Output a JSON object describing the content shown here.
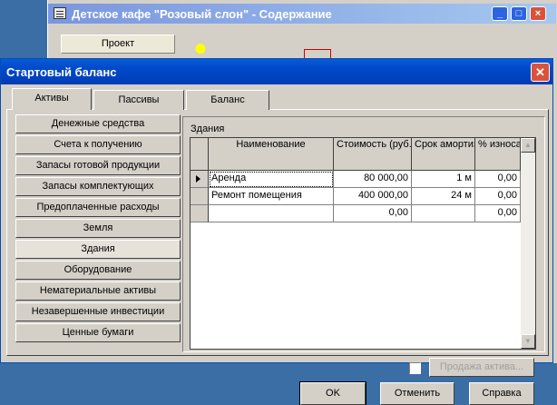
{
  "background_window": {
    "title": "Детское кафе \"Розовый слон\" - Содержание",
    "project_button": "Проект"
  },
  "dialog": {
    "title": "Стартовый баланс",
    "tabs": [
      {
        "label": "Активы",
        "active": true
      },
      {
        "label": "Пассивы",
        "active": false
      },
      {
        "label": "Баланс",
        "active": false
      }
    ],
    "categories": [
      {
        "label": "Денежные средства"
      },
      {
        "label": "Счета к получению"
      },
      {
        "label": "Запасы готовой продукции"
      },
      {
        "label": "Запасы комплектующих"
      },
      {
        "label": "Предоплаченные расходы"
      },
      {
        "label": "Земля"
      },
      {
        "label": "Здания",
        "active": true
      },
      {
        "label": "Оборудование"
      },
      {
        "label": "Нематериальные активы"
      },
      {
        "label": "Незавершенные инвестиции"
      },
      {
        "label": "Ценные бумаги"
      }
    ],
    "section_title": "Здания",
    "table": {
      "columns": [
        {
          "label": "Наименование"
        },
        {
          "label": "Стоимость (руб.)"
        },
        {
          "label": "Срок амортиз."
        },
        {
          "label": "% износа"
        }
      ],
      "rows": [
        {
          "name": "Аренда",
          "cost": "80 000,00",
          "term": "1 м",
          "wear": "0,00",
          "current": true
        },
        {
          "name": "Ремонт помещения",
          "cost": "400 000,00",
          "term": "24 м",
          "wear": "0,00"
        },
        {
          "name": "",
          "cost": "0,00",
          "term": "",
          "wear": "0,00"
        }
      ]
    },
    "sale_label": "Продажа актива...",
    "buttons": {
      "ok": "OK",
      "cancel": "Отменить",
      "help": "Справка"
    }
  },
  "icons": {
    "close": "close-icon",
    "minimize": "minimize-icon",
    "maximize": "maximize-icon",
    "current_row": "row-pointer-icon"
  },
  "colors": {
    "titlebar": "#0049c8",
    "face": "#d4d0c8",
    "close_button": "#d9533b"
  }
}
